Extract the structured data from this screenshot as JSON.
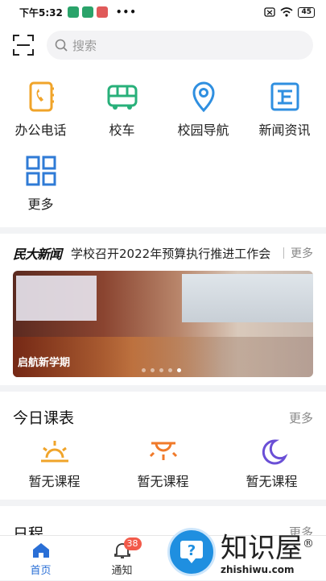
{
  "status_bar": {
    "time": "下午5:32",
    "dots": "•••",
    "battery": "45"
  },
  "search": {
    "placeholder": "搜索"
  },
  "grid": [
    {
      "label": "办公电话",
      "icon": "phone-book-icon",
      "color": "#f0a42a"
    },
    {
      "label": "校车",
      "icon": "bus-icon",
      "color": "#28b07a"
    },
    {
      "label": "校园导航",
      "icon": "location-pin-icon",
      "color": "#2f8fe0"
    },
    {
      "label": "新闻资讯",
      "icon": "news-icon",
      "color": "#2f8fe0"
    },
    {
      "label": "更多",
      "icon": "grid-more-icon",
      "color": "#2f7bd6"
    }
  ],
  "news": {
    "logo": "民大新闻",
    "headline": "学校召开2022年预算执行推进工作会",
    "more": "更多",
    "banner_caption": "启航新学期",
    "banner_pages": 5,
    "banner_active": 5
  },
  "courses": {
    "title": "今日课表",
    "more": "更多",
    "items": [
      {
        "label": "暂无课程",
        "icon": "sunrise-icon",
        "color": "#f0a42a"
      },
      {
        "label": "暂无课程",
        "icon": "sun-icon",
        "color": "#f07a2a"
      },
      {
        "label": "暂无课程",
        "icon": "moon-icon",
        "color": "#6a4fd6"
      }
    ]
  },
  "schedule": {
    "title": "日程",
    "more": "更多"
  },
  "tabs": [
    {
      "label": "首页",
      "icon": "home-icon",
      "active": true
    },
    {
      "label": "通知",
      "icon": "bell-icon",
      "badge": "38"
    },
    {
      "label": "",
      "icon": "apps-icon"
    },
    {
      "label": "",
      "icon": "profile-icon"
    }
  ],
  "watermark": {
    "name": "知识屋",
    "domain": "zhishiwu.com",
    "mark": "®"
  },
  "colors": {
    "accent": "#2a6fd6",
    "badge": "#f25a4a"
  }
}
